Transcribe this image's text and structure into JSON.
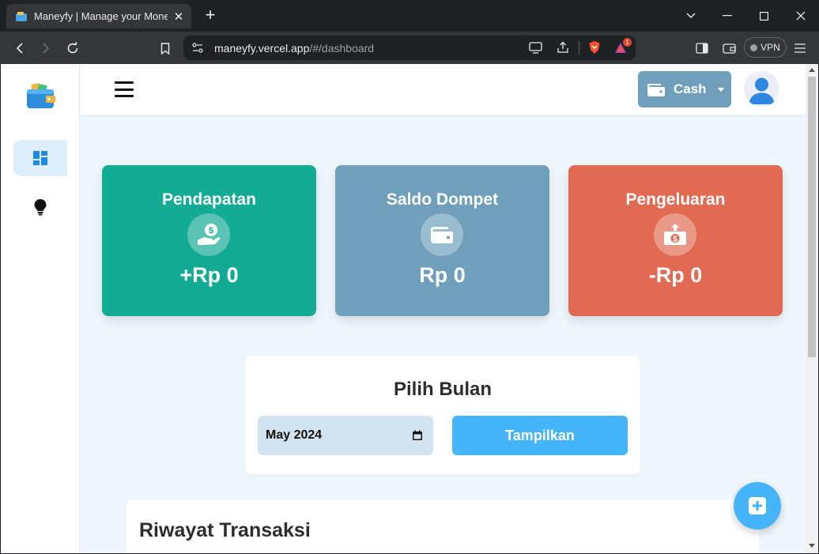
{
  "browser": {
    "tab_title": "Maneyfy | Manage your Money",
    "url_host": "maneyfy.vercel.app",
    "url_path": "/#/dashboard",
    "vpn_label": "VPN",
    "notification_count": "1"
  },
  "app": {
    "wallet_selector": {
      "label": "Cash"
    },
    "sidebar": {
      "items": [
        {
          "icon": "dashboard-icon",
          "active": true
        },
        {
          "icon": "lightbulb-icon",
          "active": false
        }
      ]
    },
    "cards": [
      {
        "title": "Pendapatan",
        "value": "+Rp 0",
        "color": "#14ab94",
        "icon": "money-hand-icon"
      },
      {
        "title": "Saldo Dompet",
        "value": "Rp 0",
        "color": "#6f9fba",
        "icon": "wallet-icon"
      },
      {
        "title": "Pengeluaran",
        "value": "-Rp 0",
        "color": "#e06a52",
        "icon": "money-envelope-icon"
      }
    ],
    "month_picker": {
      "title": "Pilih Bulan",
      "value": "May 2024",
      "button_label": "Tampilkan"
    },
    "history": {
      "title": "Riwayat Transaksi"
    },
    "colors": {
      "accent": "#46b4f8",
      "background": "#f0f6fd"
    }
  }
}
